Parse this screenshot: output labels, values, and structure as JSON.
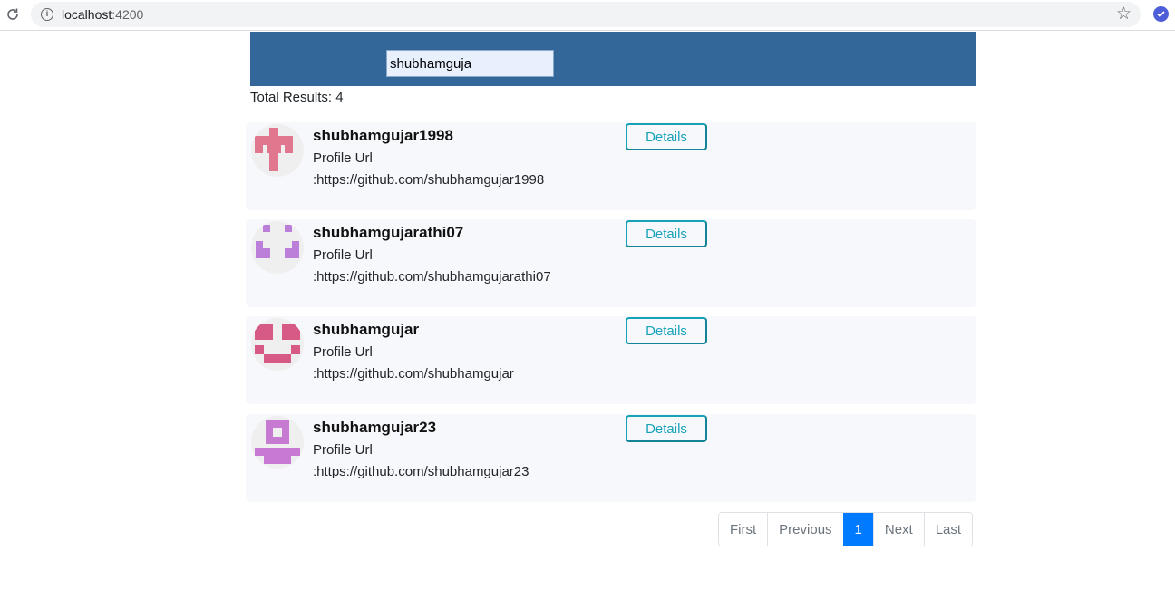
{
  "browser": {
    "url_host": "localhost",
    "url_port": ":4200"
  },
  "search": {
    "value": "shubhamguja"
  },
  "total_results": "Total Results: 4",
  "results": [
    {
      "login": "shubhamgujar1998",
      "profile_label": "Profile Url",
      "profile_url": ":https://github.com/shubhamgujar1998",
      "details_label": "Details",
      "avatar_color": "#e0778f"
    },
    {
      "login": "shubhamgujarathi07",
      "profile_label": "Profile Url",
      "profile_url": ":https://github.com/shubhamgujarathi07",
      "details_label": "Details",
      "avatar_color": "#bb7fd9"
    },
    {
      "login": "shubhamgujar",
      "profile_label": "Profile Url",
      "profile_url": ":https://github.com/shubhamgujar",
      "details_label": "Details",
      "avatar_color": "#d65a85"
    },
    {
      "login": "shubhamgujar23",
      "profile_label": "Profile Url",
      "profile_url": ":https://github.com/shubhamgujar23",
      "details_label": "Details",
      "avatar_color": "#c77ad1"
    }
  ],
  "pagination": {
    "first": "First",
    "previous": "Previous",
    "current": "1",
    "next": "Next",
    "last": "Last"
  },
  "colors": {
    "header_bg": "#336699",
    "details_accent": "#17a2b8",
    "page_active": "#007bff"
  },
  "icons": {
    "reload": "reload-icon",
    "info": "info-icon",
    "star": "star-icon",
    "extension": "extension-icon"
  }
}
